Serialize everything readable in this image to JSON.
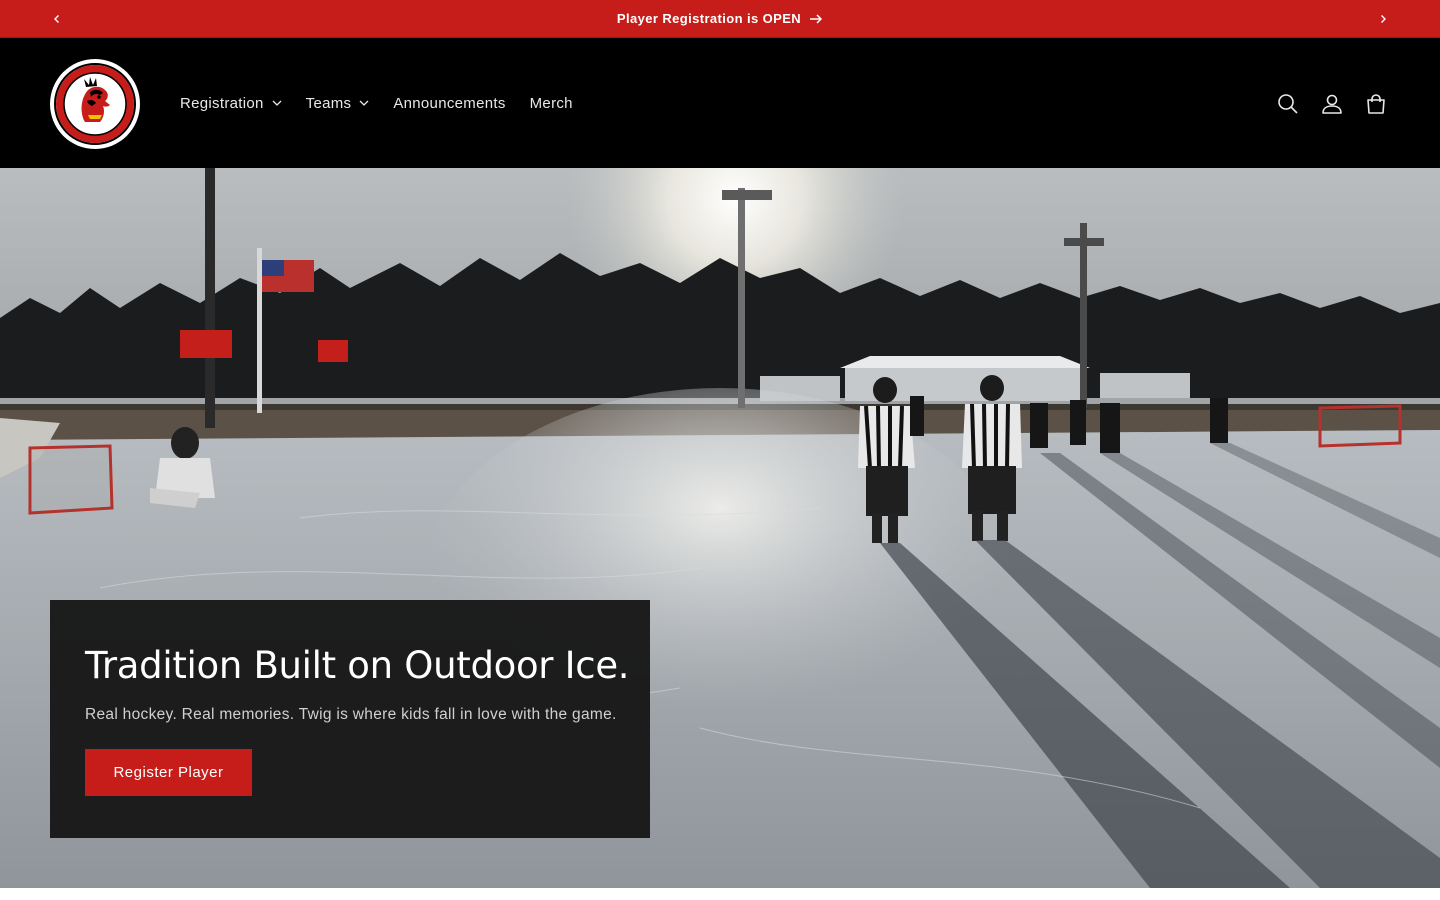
{
  "announcement": {
    "text": "Player Registration is OPEN",
    "prev_icon": "chevron-left-icon",
    "next_icon": "chevron-right-icon",
    "arrow_icon": "arrow-right-icon",
    "background": "#c71d1a"
  },
  "header": {
    "logo": {
      "top_text": "TWIG",
      "bottom_text": "BLACKHAWKS"
    },
    "nav": [
      {
        "label": "Registration",
        "has_dropdown": true
      },
      {
        "label": "Teams",
        "has_dropdown": true
      },
      {
        "label": "Announcements",
        "has_dropdown": false
      },
      {
        "label": "Merch",
        "has_dropdown": false
      }
    ],
    "icons": [
      "search-icon",
      "account-icon",
      "cart-icon"
    ],
    "background": "#000000"
  },
  "hero": {
    "title": "Tradition Built on Outdoor Ice.",
    "subtitle": "Real hockey. Real memories. Twig is where kids fall in love with the game.",
    "button_label": "Register Player",
    "accent": "#c71d1a"
  }
}
